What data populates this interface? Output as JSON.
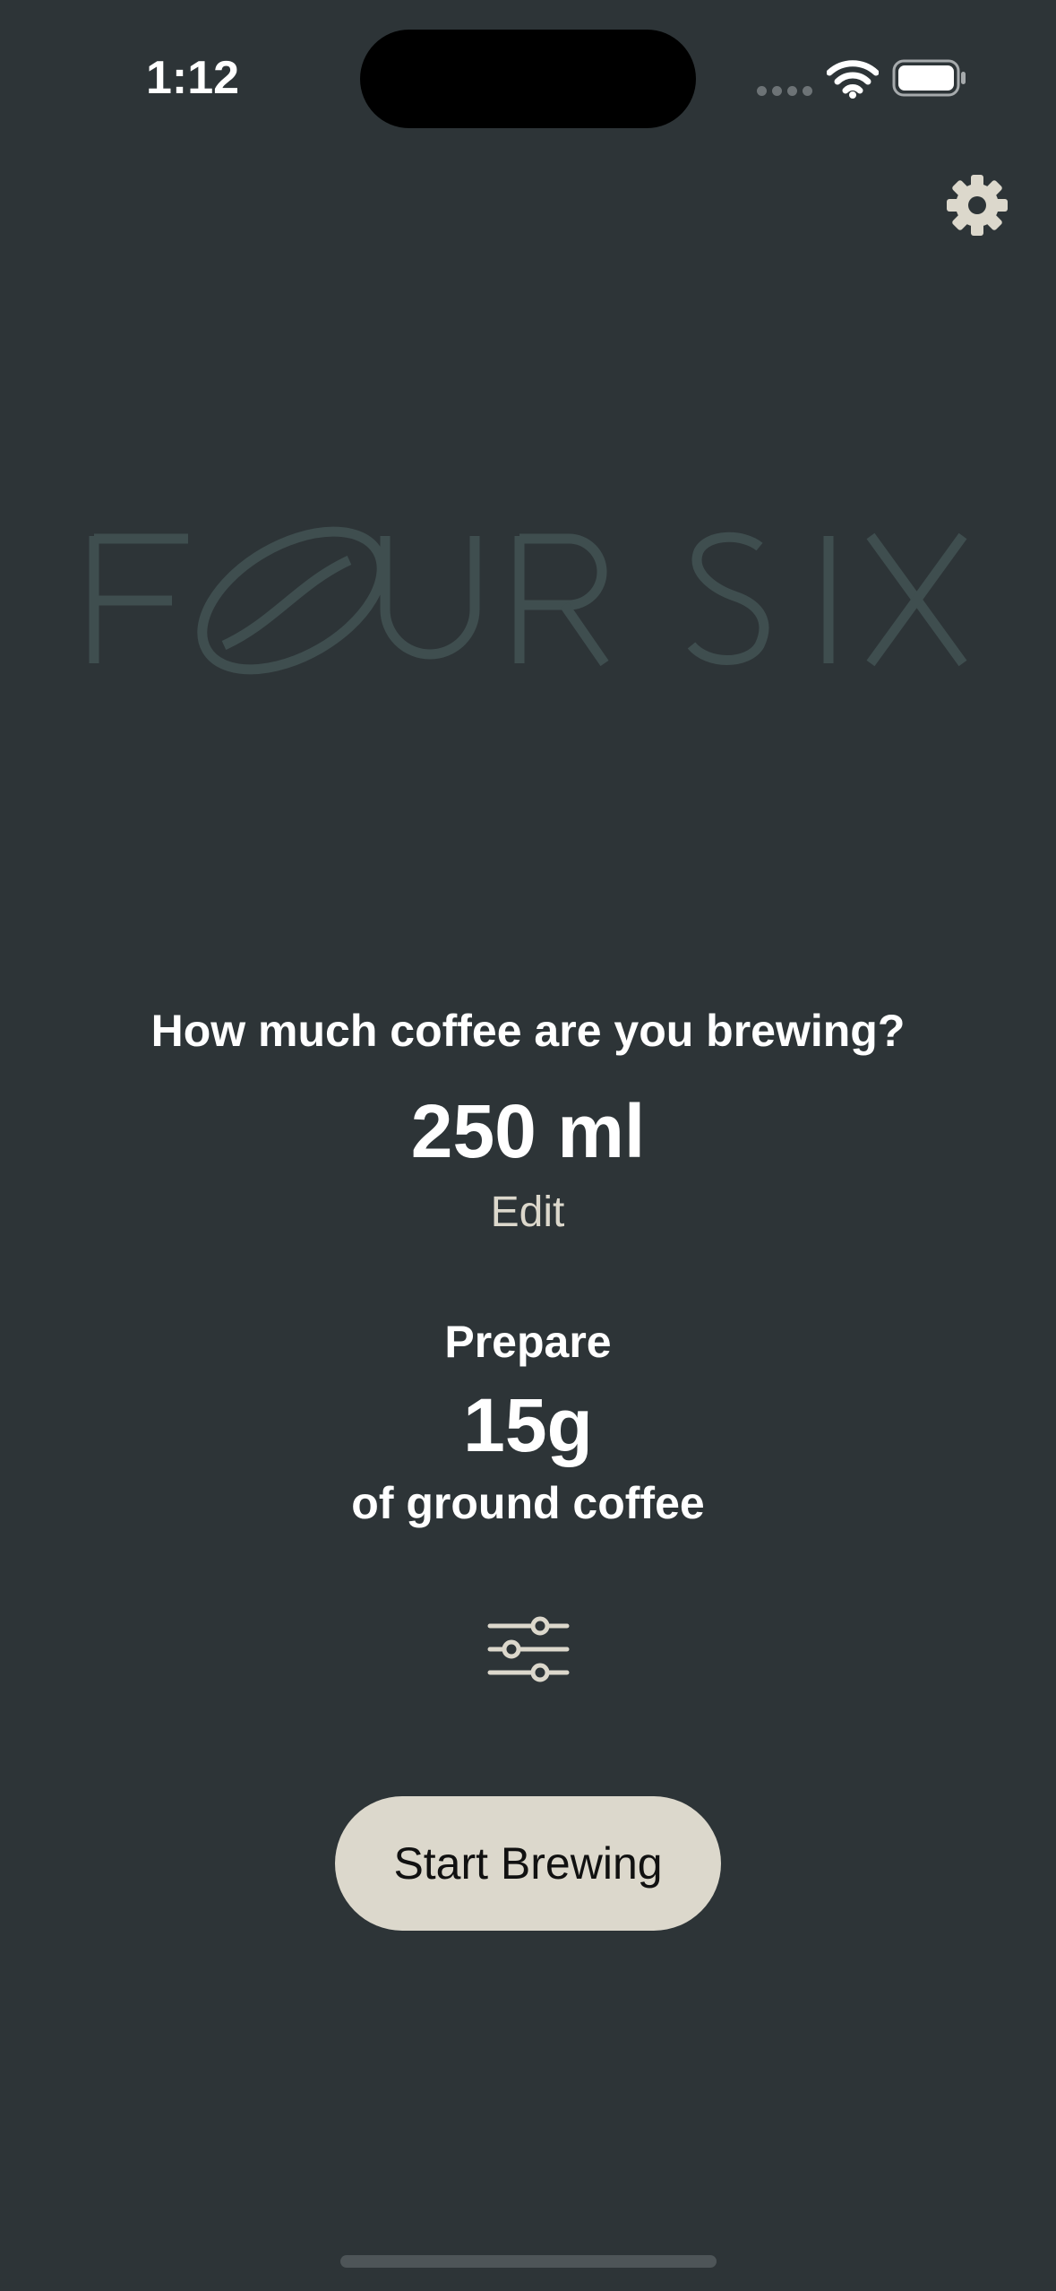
{
  "status_bar": {
    "time": "1:12",
    "icons": [
      "signal-dots-icon",
      "wifi-icon",
      "battery-icon"
    ]
  },
  "header": {
    "settings_icon": "gear-icon"
  },
  "logo": {
    "text": "FOUR SIX",
    "letters": [
      "F",
      "U",
      "R",
      "S",
      "I",
      "X"
    ],
    "bean_icon": "coffee-bean-icon",
    "color": "#3f4e4f"
  },
  "brew": {
    "question": "How much coffee are you brewing?",
    "volume": "250 ml",
    "edit_label": "Edit"
  },
  "prepare": {
    "label": "Prepare",
    "amount": "15g",
    "unit_description": "of ground coffee"
  },
  "controls": {
    "adjust_icon": "sliders-icon",
    "start_button_label": "Start Brewing"
  },
  "colors": {
    "background": "#2d3437",
    "accent": "#dcd8cc",
    "text": "#ffffff",
    "logo": "#3f4e4f"
  }
}
